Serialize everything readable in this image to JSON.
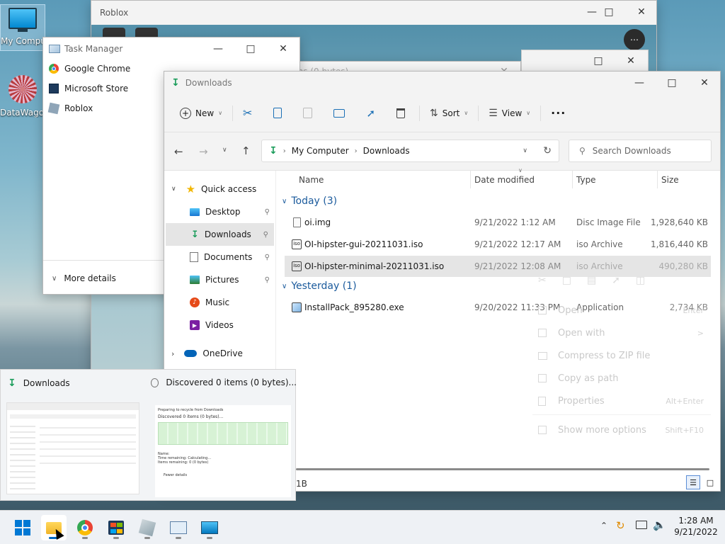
{
  "desktop": {
    "icons": [
      {
        "label": "My Computer"
      },
      {
        "label": "DataWagon"
      }
    ]
  },
  "roblox_window": {
    "title": "Roblox"
  },
  "task_manager": {
    "title": "Task Manager",
    "apps": [
      {
        "label": "Google Chrome",
        "icon": "chrome-icon"
      },
      {
        "label": "Microsoft Store",
        "icon": "store-icon"
      },
      {
        "label": "Roblox",
        "icon": "roblox-icon"
      }
    ],
    "more_details": "More details"
  },
  "progress_window": {
    "title": "Discovered 0 items (0 bytes)"
  },
  "explorer": {
    "title": "Downloads",
    "toolbar": {
      "new_label": "New",
      "sort_label": "Sort",
      "view_label": "View"
    },
    "address": {
      "crumb_root": "My Computer",
      "crumb_current": "Downloads"
    },
    "search_placeholder": "Search Downloads",
    "nav": {
      "quick_access": "Quick access",
      "items": [
        {
          "label": "Desktop",
          "pinned": true
        },
        {
          "label": "Downloads",
          "pinned": true,
          "selected": true
        },
        {
          "label": "Documents",
          "pinned": true
        },
        {
          "label": "Pictures",
          "pinned": true
        },
        {
          "label": "Music",
          "pinned": false
        },
        {
          "label": "Videos",
          "pinned": false
        }
      ],
      "onedrive": "OneDrive"
    },
    "columns": {
      "name": "Name",
      "date": "Date modified",
      "type": "Type",
      "size": "Size"
    },
    "groups": [
      {
        "label": "Today (3)",
        "files": [
          {
            "name": "oi.img",
            "date": "9/21/2022 1:12 AM",
            "type": "Disc Image File",
            "size": "1,928,640 KB"
          },
          {
            "name": "OI-hipster-gui-20211031.iso",
            "date": "9/21/2022 12:17 AM",
            "type": "iso Archive",
            "size": "1,816,440 KB"
          },
          {
            "name": "OI-hipster-minimal-20211031.iso",
            "date": "9/21/2022 12:08 AM",
            "type": "iso Archive",
            "size": "490,280 KB"
          }
        ]
      },
      {
        "label": "Yesterday (1)",
        "files": [
          {
            "name": "InstallPack_895280.exe",
            "date": "9/20/2022 11:33 PM",
            "type": "Application",
            "size": "2,734 KB"
          }
        ]
      }
    ],
    "status_text": "1B"
  },
  "context_menu": {
    "items": [
      {
        "label": "Open",
        "shortcut": "Enter"
      },
      {
        "label": "Open with",
        "shortcut": ">"
      },
      {
        "label": "Compress to ZIP file",
        "shortcut": ""
      },
      {
        "label": "Copy as path",
        "shortcut": ""
      },
      {
        "label": "Properties",
        "shortcut": "Alt+Enter"
      },
      {
        "label": "Show more options",
        "shortcut": "Shift+F10"
      }
    ]
  },
  "taskbar_preview": {
    "items": [
      {
        "title": "Downloads"
      },
      {
        "title": "Discovered 0 items (0 bytes)..."
      }
    ],
    "thumb_text": {
      "preparing": "Preparing to recycle from Downloads",
      "discovered": "Discovered 0 items (0 bytes)...",
      "name": "Name:",
      "time": "Time remaining: Calculating...",
      "items": "Items remaining: 0 (0 bytes)",
      "fewer": "Fewer details"
    }
  },
  "taskbar": {
    "time": "1:28 AM",
    "date": "9/21/2022"
  },
  "colors": {
    "accent": "#0067c0",
    "download_green": "#1a9c5a",
    "selection": "#e5e5e5"
  }
}
